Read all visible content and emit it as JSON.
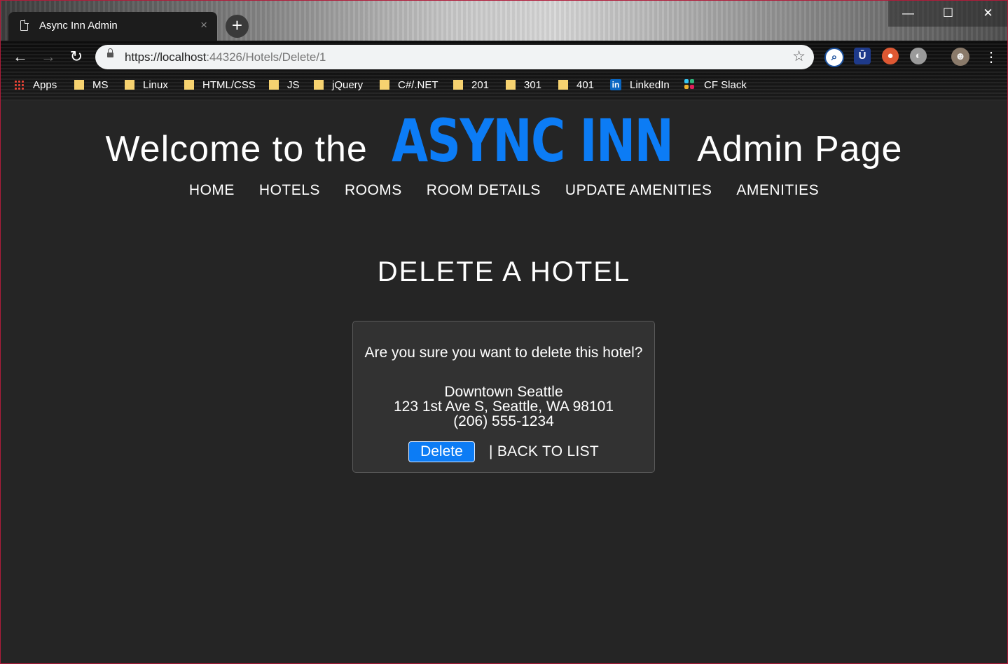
{
  "browser": {
    "tab_title": "Async Inn Admin",
    "tab_close": "×",
    "new_tab": "+",
    "url_host": "https://localhost",
    "url_path": ":44326/Hotels/Delete/1",
    "window_controls": {
      "minimize": "—",
      "maximize": "☐",
      "close": "✕"
    },
    "nav": {
      "back": "←",
      "forward": "→",
      "reload": "↻"
    },
    "bookmarks": [
      "Apps",
      "MS",
      "Linux",
      "HTML/CSS",
      "JS",
      "jQuery",
      "C#/.NET",
      "201",
      "301",
      "401",
      "LinkedIn",
      "CF Slack"
    ]
  },
  "header": {
    "welcome_prefix": "Welcome to the",
    "brand": "ASYNC INN",
    "welcome_suffix": "Admin Page"
  },
  "nav": {
    "items": [
      "HOME",
      "HOTELS",
      "ROOMS",
      "ROOM DETAILS",
      "UPDATE AMENITIES",
      "AMENITIES"
    ]
  },
  "page": {
    "title": "DELETE A HOTEL"
  },
  "confirm": {
    "question": "Are you sure you want to delete this hotel?",
    "hotel_name": "Downtown Seattle",
    "hotel_address": "123 1st Ave S, Seattle, WA 98101",
    "hotel_phone": "(206) 555-1234",
    "delete_label": "Delete",
    "back_label": "| BACK TO LIST"
  },
  "colors": {
    "brand_blue": "#0c7cf5",
    "page_background": "#252525",
    "card_background": "#323232"
  }
}
